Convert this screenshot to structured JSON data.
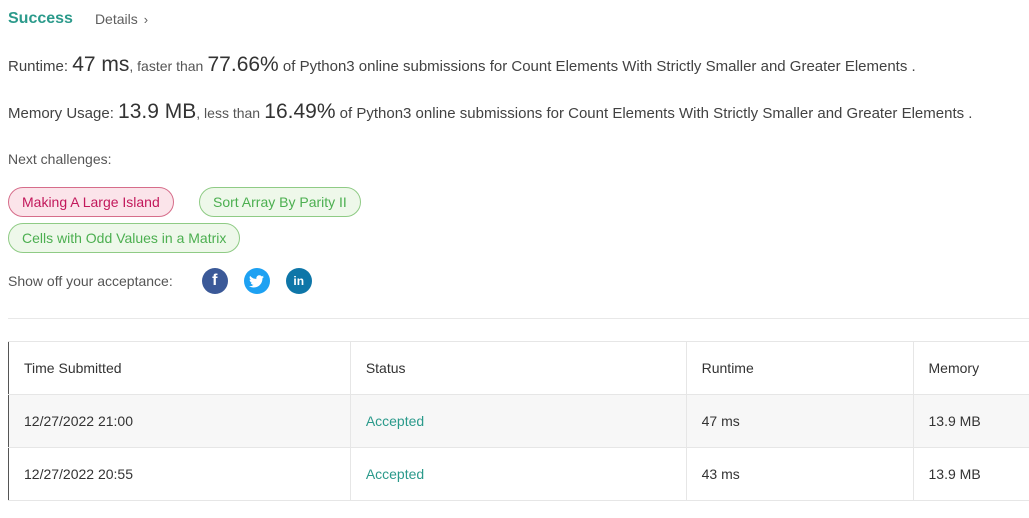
{
  "header": {
    "status": "Success",
    "details_label": "Details",
    "details_chevron": "›"
  },
  "runtime": {
    "label": "Runtime:",
    "value": "47 ms",
    "comparison": ", faster than",
    "percent": "77.66%",
    "suffix": "of Python3 online submissions for Count Elements With Strictly Smaller and Greater Elements ."
  },
  "memory": {
    "label": "Memory Usage:",
    "value": "13.9 MB",
    "comparison": ", less than",
    "percent": "16.49%",
    "suffix": "of Python3 online submissions for Count Elements With Strictly Smaller and Greater Elements ."
  },
  "next_challenges": {
    "label": "Next challenges:",
    "items": [
      {
        "label": "Making A Large Island",
        "difficulty": "hard"
      },
      {
        "label": "Sort Array By Parity II",
        "difficulty": "easy"
      },
      {
        "label": "Cells with Odd Values in a Matrix",
        "difficulty": "easy"
      }
    ]
  },
  "share": {
    "label": "Show off your acceptance:",
    "icons": [
      "facebook-icon",
      "twitter-icon",
      "linkedin-icon"
    ],
    "facebook_glyph": "f",
    "linkedin_glyph": "in"
  },
  "table": {
    "headers": [
      "Time Submitted",
      "Status",
      "Runtime",
      "Memory"
    ],
    "rows": [
      {
        "time": "12/27/2022 21:00",
        "status": "Accepted",
        "runtime": "47 ms",
        "memory": "13.9 MB"
      },
      {
        "time": "12/27/2022 20:55",
        "status": "Accepted",
        "runtime": "43 ms",
        "memory": "13.9 MB"
      }
    ]
  },
  "colors": {
    "accent": "#2b9a8b",
    "hard": "#c2185b",
    "easy": "#4caf50",
    "facebook": "#3b5998",
    "twitter": "#1da1f2",
    "linkedin": "#0e76a8"
  }
}
